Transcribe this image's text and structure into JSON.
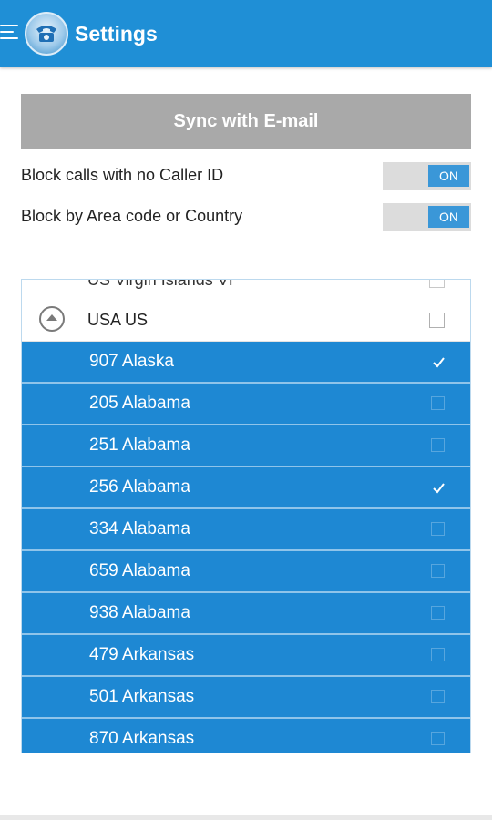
{
  "header": {
    "title": "Settings",
    "menu_icon": "hamburger-menu-icon",
    "logo_icon": "phone-logo-icon",
    "color": "#1f8fd6"
  },
  "sync_button": {
    "label": "Sync with E-mail"
  },
  "settings": [
    {
      "label": "Block calls with no Caller ID",
      "toggle": "ON"
    },
    {
      "label": "Block by Area code or Country",
      "toggle": "ON"
    }
  ],
  "list": {
    "partial_item": {
      "label": "US Virgin Islands VI",
      "checked": false
    },
    "group": {
      "label": "USA US",
      "checked": false,
      "expanded": true
    },
    "items": [
      {
        "label": "907 Alaska",
        "checked": true
      },
      {
        "label": "205 Alabama",
        "checked": false
      },
      {
        "label": "251 Alabama",
        "checked": false
      },
      {
        "label": "256 Alabama",
        "checked": true
      },
      {
        "label": "334 Alabama",
        "checked": false
      },
      {
        "label": "659 Alabama",
        "checked": false
      },
      {
        "label": "938 Alabama",
        "checked": false
      },
      {
        "label": "479 Arkansas",
        "checked": false
      },
      {
        "label": "501 Arkansas",
        "checked": false
      },
      {
        "label": "870 Arkansas",
        "checked": false
      }
    ],
    "item_color": "#1e88d3"
  }
}
